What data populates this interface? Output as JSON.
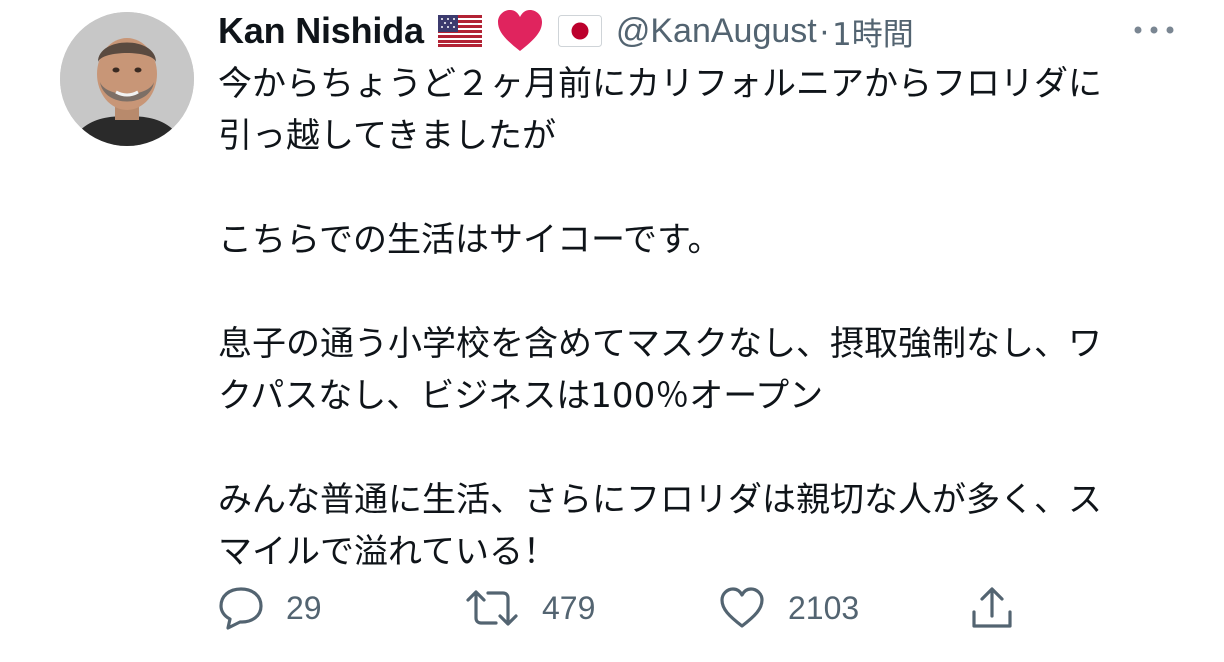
{
  "tweet": {
    "author": {
      "display_name": "Kan Nishida",
      "handle": "@KanAugust",
      "name_emojis": [
        "us-flag-emoji",
        "red-heart-emoji",
        "japan-flag-emoji"
      ]
    },
    "separator": "·",
    "timestamp": "1時間",
    "paragraphs": [
      "今からちょうど２ヶ月前にカリフォルニアからフロリダに\n引っ越してきましたが",
      "こちらでの生活はサイコーです。",
      "息子の通う小学校を含めてマスクなし、摂取強制なし、ワ\nクパスなし、ビジネスは100％オープン",
      "みんな普通に生活、さらにフロリダは親切な人が多く、ス\nマイルで溢れている！"
    ],
    "stats": {
      "replies": "29",
      "retweets": "479",
      "likes": "2103"
    }
  },
  "icons": {
    "more": "more-dots-icon",
    "reply": "reply-bubble-icon",
    "retweet": "retweet-icon",
    "like": "heart-outline-icon",
    "share": "share-upload-icon"
  },
  "colors": {
    "text": "#0f1419",
    "secondary": "#536471",
    "heart_emoji": "#e0245e",
    "flag_red": "#bc002d"
  }
}
